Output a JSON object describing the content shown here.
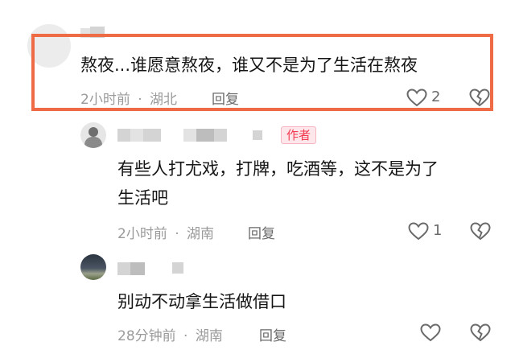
{
  "comments": [
    {
      "content": "熬夜...谁愿意熬夜，谁又不是为了生活在熬夜",
      "time": "2小时前",
      "location": "湖北",
      "reply_label": "回复",
      "like_count": "2"
    },
    {
      "author_badge": "作者",
      "content_line1": "有些人打尤戏，打牌，吃酒等，这不是为了",
      "content_line2": "生活吧",
      "time": "2小时前",
      "location": "湖南",
      "reply_label": "回复",
      "like_count": "1"
    },
    {
      "content": "别动不动拿生活做借口",
      "time": "28分钟前",
      "location": "湖南",
      "reply_label": "回复",
      "like_count": ""
    }
  ],
  "separator": "·",
  "colors": {
    "highlight": "#ef6b46",
    "badge": "#f23a52"
  },
  "icons": [
    "heart-outline-icon",
    "broken-heart-icon",
    "user-avatar"
  ]
}
